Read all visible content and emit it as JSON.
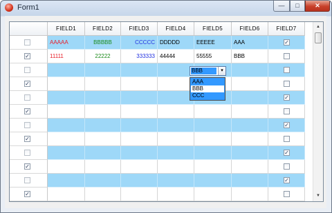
{
  "window": {
    "title": "Form1",
    "minimize_glyph": "—",
    "maximize_glyph": "□",
    "close_glyph": "✕"
  },
  "grid": {
    "columns": [
      "FIELD1",
      "FIELD2",
      "FIELD3",
      "FIELD4",
      "FIELD5",
      "FIELD6",
      "FIELD7"
    ],
    "rows": [
      {
        "select": false,
        "field1": "AAAAA",
        "field2": "BBBBB",
        "field3": "CCCCC",
        "field4": "DDDDD",
        "field5": "EEEEE",
        "field6": "AAA",
        "field7": true,
        "alt": true
      },
      {
        "select": true,
        "field1": "11111",
        "field2": "22222",
        "field3": "333333",
        "field4": "44444",
        "field5": "55555",
        "field6": "BBB",
        "field7": false,
        "alt": false
      },
      {
        "select": false,
        "field1": "",
        "field2": "",
        "field3": "",
        "field4": "",
        "field5": "",
        "field6": "",
        "field7": false,
        "alt": true
      },
      {
        "select": true,
        "field1": "",
        "field2": "",
        "field3": "",
        "field4": "",
        "field5": "",
        "field6": "",
        "field7": false,
        "alt": false
      },
      {
        "select": false,
        "field1": "",
        "field2": "",
        "field3": "",
        "field4": "",
        "field5": "",
        "field6": "",
        "field7": true,
        "alt": true
      },
      {
        "select": true,
        "field1": "",
        "field2": "",
        "field3": "",
        "field4": "",
        "field5": "",
        "field6": "",
        "field7": false,
        "alt": false
      },
      {
        "select": false,
        "field1": "",
        "field2": "",
        "field3": "",
        "field4": "",
        "field5": "",
        "field6": "",
        "field7": true,
        "alt": true
      },
      {
        "select": true,
        "field1": "",
        "field2": "",
        "field3": "",
        "field4": "",
        "field5": "",
        "field6": "",
        "field7": false,
        "alt": false
      },
      {
        "select": false,
        "field1": "",
        "field2": "",
        "field3": "",
        "field4": "",
        "field5": "",
        "field6": "",
        "field7": true,
        "alt": true
      },
      {
        "select": true,
        "field1": "",
        "field2": "",
        "field3": "",
        "field4": "",
        "field5": "",
        "field6": "",
        "field7": false,
        "alt": false
      },
      {
        "select": false,
        "field1": "",
        "field2": "",
        "field3": "",
        "field4": "",
        "field5": "",
        "field6": "",
        "field7": true,
        "alt": true
      },
      {
        "select": true,
        "field1": "",
        "field2": "",
        "field3": "",
        "field4": "",
        "field5": "",
        "field6": "",
        "field7": false,
        "alt": false
      }
    ],
    "text_colors": {
      "field1": "#e8202a",
      "field2": "#1a8a1a",
      "field3": "#2030e0",
      "default": "#000000"
    },
    "check_glyph": "✓"
  },
  "combo": {
    "value": "BBB",
    "arrow_glyph": "▾",
    "options": [
      "AAA",
      "BBB",
      "CCC"
    ],
    "selected_index": 1
  },
  "scrollbar": {
    "up_glyph": "▲",
    "down_glyph": "▼"
  },
  "colors": {
    "alt_row": "#9ed8f8",
    "selection": "#3399ff"
  }
}
